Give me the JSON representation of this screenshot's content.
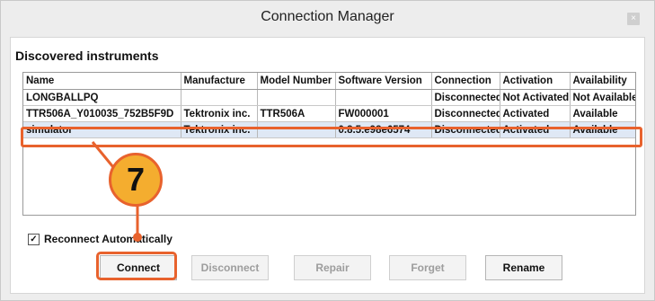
{
  "window": {
    "title": "Connection Manager",
    "close_glyph": "×"
  },
  "section_title": "Discovered instruments",
  "table": {
    "columns": [
      "Name",
      "Manufacture",
      "Model Number",
      "Software Version",
      "Connection",
      "Activation",
      "Availability"
    ],
    "rows": [
      [
        "LONGBALLPQ",
        "",
        "",
        "",
        "Disconnected",
        "Not Activated",
        "Not Available"
      ],
      [
        "TTR506A_Y010035_752B5F9D",
        "Tektronix inc.",
        "TTR506A",
        "FW000001",
        "Disconnected",
        "Activated",
        "Available"
      ],
      [
        "simulator",
        "Tektronix inc.",
        "",
        "0.8.5.e98e6574",
        "Disconnected",
        "Activated",
        "Available"
      ]
    ]
  },
  "reconnect": {
    "label": "Reconnect Automatically",
    "checked": true
  },
  "buttons": {
    "connect": "Connect",
    "disconnect": "Disconnect",
    "repair": "Repair",
    "forget": "Forget",
    "rename": "Rename"
  },
  "annotation": {
    "step": "7",
    "color": "#e8622d",
    "fill": "#f4ad2f"
  }
}
